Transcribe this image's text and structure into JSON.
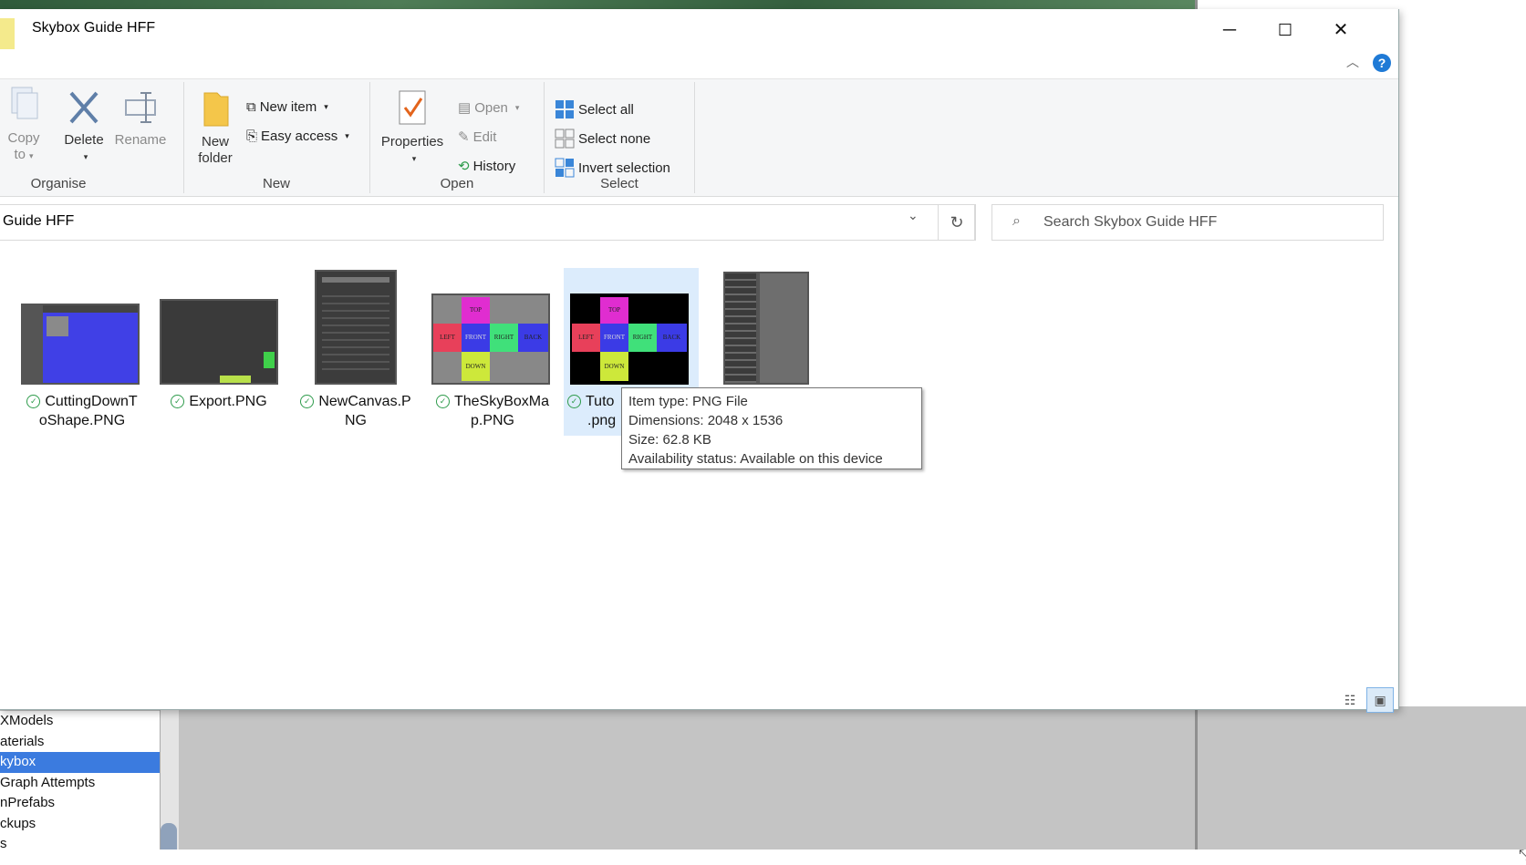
{
  "window": {
    "title": "Skybox Guide HFF",
    "minimize": "─",
    "maximize": "☐",
    "close": "✕"
  },
  "ribbon": {
    "organise": {
      "label": "Organise",
      "copy_to": "Copy to",
      "copy_line1": "Copy",
      "copy_line2": "to",
      "delete": "Delete",
      "rename": "Rename"
    },
    "new": {
      "label": "New",
      "new_folder_line1": "New",
      "new_folder_line2": "folder",
      "new_item": "New item",
      "easy_access": "Easy access"
    },
    "open": {
      "label": "Open",
      "properties": "Properties",
      "open": "Open",
      "edit": "Edit",
      "history": "History"
    },
    "select": {
      "label": "Select",
      "select_all": "Select all",
      "select_none": "Select none",
      "invert_selection": "Invert selection"
    }
  },
  "address": {
    "path": "Guide HFF",
    "search_placeholder": "Search Skybox Guide HFF"
  },
  "files": [
    {
      "name_l1": "CuttingDownT",
      "name_l2": "oShape.PNG"
    },
    {
      "name_l1": "Export.PNG",
      "name_l2": ""
    },
    {
      "name_l1": "NewCanvas.P",
      "name_l2": "NG"
    },
    {
      "name_l1": "TheSkyBoxMa",
      "name_l2": "p.PNG"
    },
    {
      "name_l1": "Tuto",
      "name_l2": ".png"
    },
    {
      "name_l1": "",
      "name_l2": ""
    }
  ],
  "skybox_faces": {
    "top": "TOP",
    "left": "LEFT",
    "front": "FRONT",
    "right": "RIGHT",
    "back": "BACK",
    "down": "DOWN"
  },
  "tooltip": {
    "type": "Item type: PNG File",
    "dimensions": "Dimensions: 2048 x 1536",
    "size": "Size: 62.8 KB",
    "availability": "Availability status: Available on this device"
  },
  "background_tree": {
    "items": [
      "XModels",
      "aterials",
      "kybox",
      " Graph Attempts",
      "nPrefabs",
      "ckups",
      "s"
    ],
    "selected_index": 2
  },
  "colors": {
    "selection": "#3b7bdf",
    "accent_blue": "#1f7ad6",
    "sync_green": "#2e9b4b"
  }
}
